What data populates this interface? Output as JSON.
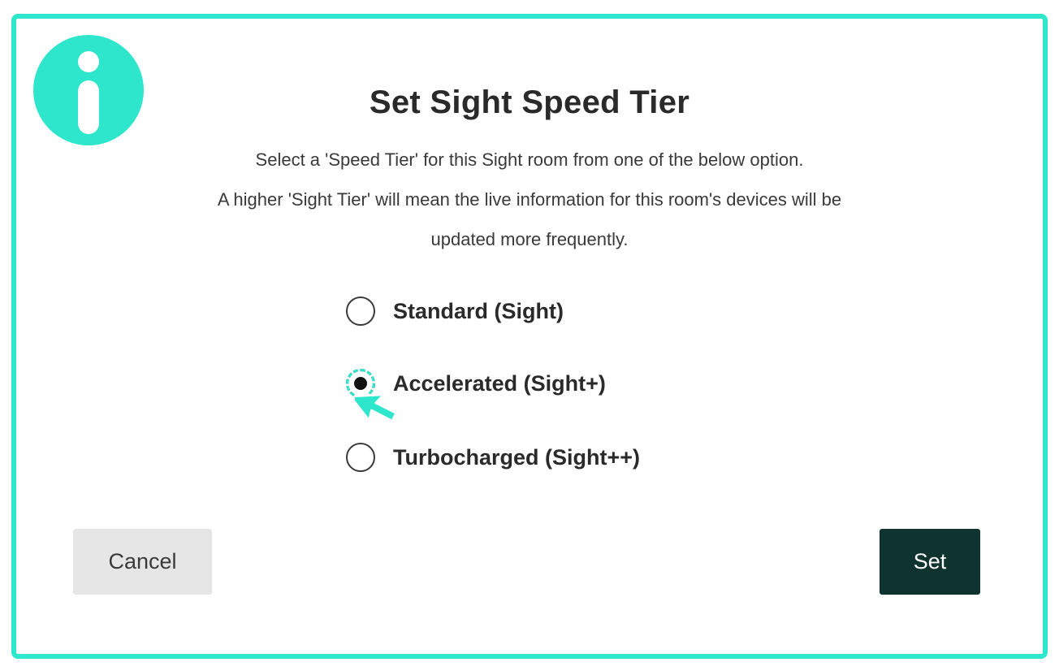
{
  "dialog": {
    "title": "Set Sight Speed Tier",
    "description": [
      "Select a 'Speed Tier' for this Sight room from one of the below option.",
      "A higher 'Sight Tier' will mean the live information for this room's devices will be",
      "updated more frequently."
    ],
    "options": [
      {
        "label": "Standard (Sight)",
        "selected": false
      },
      {
        "label": "Accelerated (Sight+)",
        "selected": true
      },
      {
        "label": "Turbocharged (Sight++)",
        "selected": false
      }
    ],
    "cancel_label": "Cancel",
    "set_label": "Set"
  },
  "icons": {
    "badge": "info-icon",
    "pointer": "cursor-arrow-icon"
  },
  "colors": {
    "accent": "#2de6cc",
    "primary_button": "#0f3430",
    "secondary_button": "#e6e6e6",
    "text": "#2a2a2a"
  }
}
